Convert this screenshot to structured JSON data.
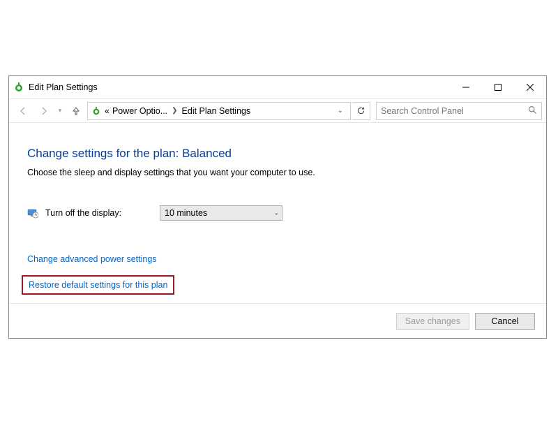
{
  "window_title": "Edit Plan Settings",
  "breadcrumb": {
    "prefix": "«",
    "item1": "Power Optio...",
    "item2": "Edit Plan Settings"
  },
  "search": {
    "placeholder": "Search Control Panel"
  },
  "heading": "Change settings for the plan: Balanced",
  "subtext": "Choose the sleep and display settings that you want your computer to use.",
  "display_row": {
    "label": "Turn off the display:",
    "value": "10 minutes"
  },
  "links": {
    "advanced": "Change advanced power settings",
    "restore": "Restore default settings for this plan"
  },
  "buttons": {
    "save": "Save changes",
    "cancel": "Cancel"
  }
}
